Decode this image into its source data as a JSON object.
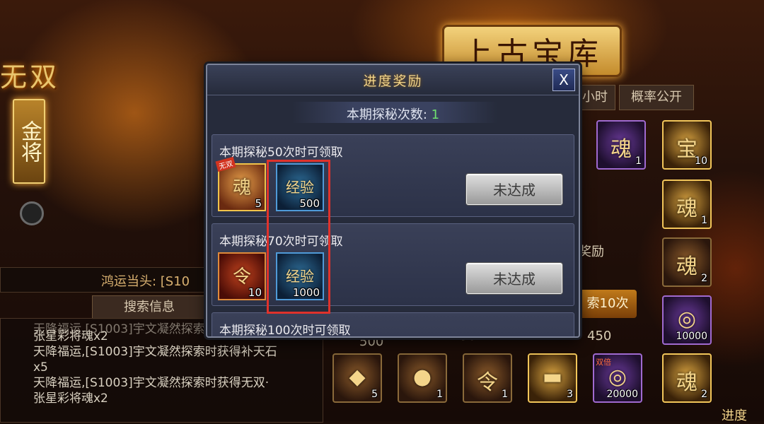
{
  "background": {
    "left_title": "无双",
    "gold_badge": "金将",
    "banner_title": "上古宝库",
    "right_tab_partial": "小时",
    "right_tab_probability": "概率公开",
    "lucky_text": "鸿运当头: [S10",
    "search_info_tab": "搜索信息",
    "reward_text_partial": "奖励",
    "ten_times_partial": "索10次",
    "cost_value": "450",
    "cost_value_partial": "30",
    "cost_500": "500",
    "log_lines": [
      "天降福运,[S1003]宇文凝然探索时获得无双·",
      "张星彩将魂x2",
      "天降福运,[S1003]宇文凝然探索时获得补天石",
      "x5",
      "天降福运,[S1003]宇文凝然探索时获得无双·",
      "张星彩将魂x2"
    ],
    "right_items": [
      {
        "icon": "hero-soul-icon",
        "glyph": "魂",
        "count": "1"
      },
      {
        "icon": "treasure-box-icon",
        "glyph": "宝",
        "count": "10"
      },
      {
        "icon": "hero-soul-icon",
        "glyph": "魂",
        "count": "1"
      },
      {
        "icon": "hero-soul-icon",
        "glyph": "魂",
        "count": "2"
      },
      {
        "icon": "coin-icon",
        "glyph": "◎",
        "count": "10000"
      }
    ],
    "bottom_items": [
      {
        "icon": "gem-icon",
        "glyph": "◆",
        "count": "5"
      },
      {
        "icon": "orb-icon",
        "glyph": "●",
        "count": "1"
      },
      {
        "icon": "scroll-icon",
        "glyph": "令",
        "count": "1"
      },
      {
        "icon": "gold-bar-icon",
        "glyph": "▬",
        "count": "3"
      },
      {
        "icon": "coin-icon",
        "glyph": "◎",
        "count": "20000"
      },
      {
        "icon": "hero-soul-icon",
        "glyph": "魂",
        "count": "2"
      }
    ],
    "double_badge": "双倍",
    "bottom_right_partial": "进度"
  },
  "dialog": {
    "title": "进度奖励",
    "close_label": "X",
    "count_label": "本期探秘次数:",
    "count_value": "1",
    "rewards": [
      {
        "title": "本期探秘50次时可领取",
        "items": [
          {
            "icon": "hero-soul-icon",
            "glyph": "魂",
            "badge": "无双",
            "count": "5"
          },
          {
            "icon": "exp-scroll-icon",
            "glyph": "经验",
            "count": "500"
          }
        ],
        "status": "未达成"
      },
      {
        "title": "本期探秘70次时可领取",
        "items": [
          {
            "icon": "command-scroll-icon",
            "glyph": "令",
            "count": "10"
          },
          {
            "icon": "exp-scroll-icon",
            "glyph": "经验",
            "count": "1000"
          }
        ],
        "status": "未达成"
      },
      {
        "title": "本期探秘100次时可领取"
      }
    ]
  },
  "colors": {
    "dialog_bg": "#262b3b",
    "title_gold": "#f2d48a",
    "count_green": "#6fe06f",
    "highlight_red": "#e0322b"
  }
}
